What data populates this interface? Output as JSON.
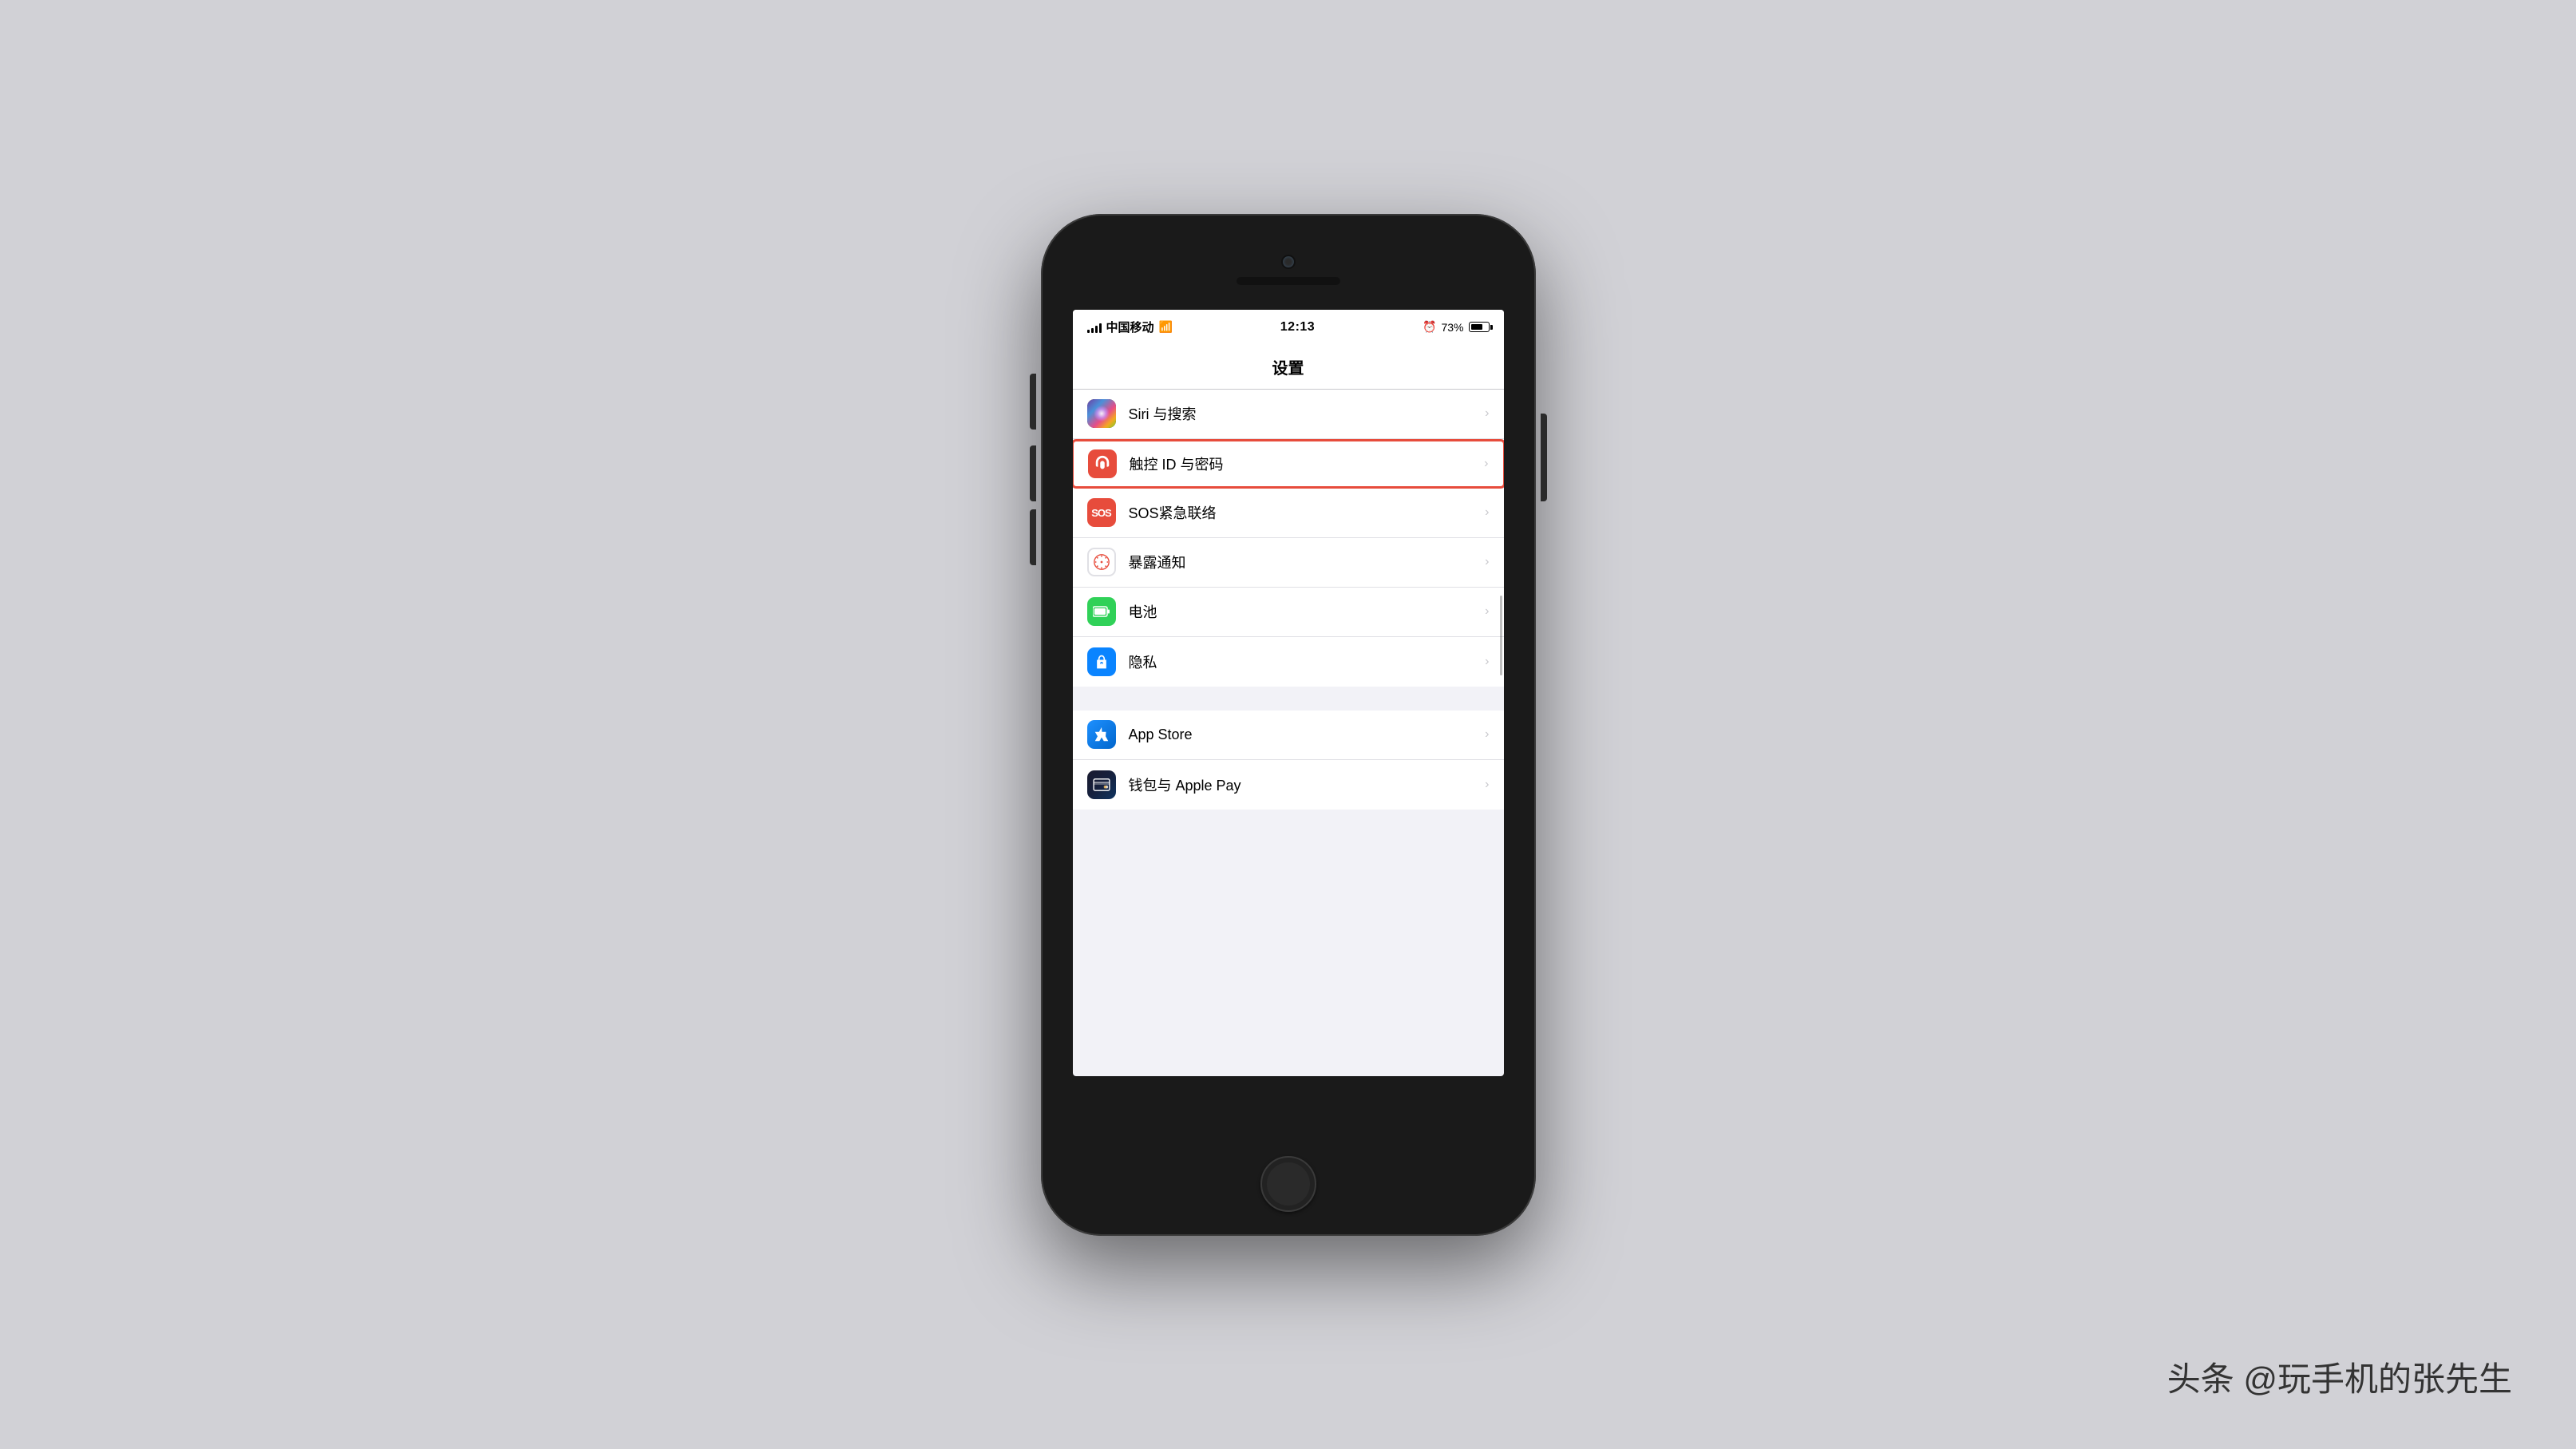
{
  "watermark": "头条 @玩手机的张先生",
  "status_bar": {
    "carrier": "中国移动",
    "time": "12:13",
    "battery_percent": "73%"
  },
  "nav": {
    "title": "设置"
  },
  "settings_items_group1": [
    {
      "id": "siri",
      "label": "Siri 与搜索",
      "icon_type": "siri",
      "highlighted": false
    },
    {
      "id": "touchid",
      "label": "触控 ID 与密码",
      "icon_type": "touchid",
      "highlighted": true
    },
    {
      "id": "sos",
      "label": "SOS紧急联络",
      "icon_type": "sos",
      "highlighted": false
    },
    {
      "id": "exposure",
      "label": "暴露通知",
      "icon_type": "exposure",
      "highlighted": false
    },
    {
      "id": "battery",
      "label": "电池",
      "icon_type": "battery",
      "highlighted": false
    },
    {
      "id": "privacy",
      "label": "隐私",
      "icon_type": "privacy",
      "highlighted": false
    }
  ],
  "settings_items_group2": [
    {
      "id": "appstore",
      "label": "App Store",
      "icon_type": "appstore",
      "highlighted": false
    },
    {
      "id": "wallet",
      "label": "钱包与 Apple Pay",
      "icon_type": "wallet",
      "highlighted": false
    }
  ]
}
